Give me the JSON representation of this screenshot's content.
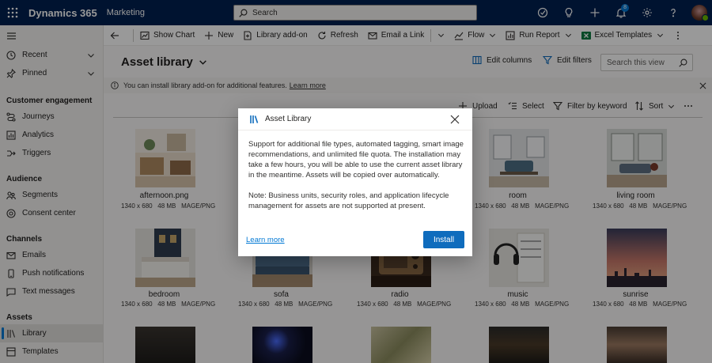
{
  "topbar": {
    "brand": "Dynamics 365",
    "app": "Marketing",
    "search_placeholder": "Search",
    "notification_count": "8"
  },
  "sidebar": {
    "items_top": [
      {
        "label": "Recent",
        "icon": "clock-icon"
      },
      {
        "label": "Pinned",
        "icon": "pin-icon"
      }
    ],
    "groups": [
      {
        "heading": "Customer engagement",
        "items": [
          "Journeys",
          "Analytics",
          "Triggers"
        ]
      },
      {
        "heading": "Audience",
        "items": [
          "Segments",
          "Consent center"
        ]
      },
      {
        "heading": "Channels",
        "items": [
          "Emails",
          "Push notifications",
          "Text messages"
        ]
      },
      {
        "heading": "Assets",
        "items": [
          "Library",
          "Templates"
        ]
      }
    ]
  },
  "commandbar": {
    "show_chart": "Show Chart",
    "new": "New",
    "library_addon": "Library add-on",
    "refresh": "Refresh",
    "email_link": "Email a Link",
    "flow": "Flow",
    "run_report": "Run Report",
    "excel_templates": "Excel Templates"
  },
  "header": {
    "title": "Asset library",
    "edit_columns": "Edit columns",
    "edit_filters": "Edit filters",
    "search_view_placeholder": "Search this view"
  },
  "infobar": {
    "message": "You can install library add-on for additional features.",
    "learn_more": "Learn more"
  },
  "tools": {
    "upload": "Upload",
    "select": "Select",
    "filter": "Filter by keyword",
    "sort": "Sort"
  },
  "assets": [
    {
      "name": "afternoon.png",
      "dims": "1340 x 680",
      "size": "48 MB",
      "type": "MAGE/PNG"
    },
    {
      "name": "",
      "dims": "",
      "size": "",
      "type": ""
    },
    {
      "name": "",
      "dims": "",
      "size": "",
      "type": ""
    },
    {
      "name": "room",
      "dims": "1340 x 680",
      "size": "48 MB",
      "type": "MAGE/PNG"
    },
    {
      "name": "living room",
      "dims": "1340 x 680",
      "size": "48 MB",
      "type": "MAGE/PNG"
    },
    {
      "name": "bedroom",
      "dims": "1340 x 680",
      "size": "48 MB",
      "type": "MAGE/PNG"
    },
    {
      "name": "sofa",
      "dims": "1340 x 680",
      "size": "48 MB",
      "type": "MAGE/PNG"
    },
    {
      "name": "radio",
      "dims": "1340 x 680",
      "size": "48 MB",
      "type": "MAGE/PNG"
    },
    {
      "name": "music",
      "dims": "1340 x 680",
      "size": "48 MB",
      "type": "MAGE/PNG"
    },
    {
      "name": "sunrise",
      "dims": "1340 x 680",
      "size": "48 MB",
      "type": "MAGE/PNG"
    }
  ],
  "dialog": {
    "title": "Asset Library",
    "body1": "Support for additional file types, automated tagging, smart image recommendations, and unlimited file quota. The installation may take a few hours, you will be able to use the current asset library in the meantime. Assets will be copied over automatically.",
    "body2": "Note: Business units, security roles, and application lifecycle management for assets are not supported at present.",
    "learn_more": "Learn more",
    "install": "Install"
  }
}
